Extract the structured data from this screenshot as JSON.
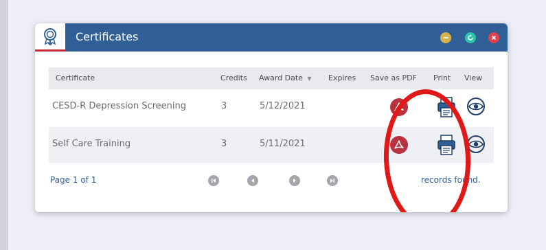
{
  "window": {
    "title": "Certificates",
    "title_icon": "award-icon",
    "controls": [
      "minimize-icon",
      "refresh-icon",
      "close-icon"
    ]
  },
  "table": {
    "headers": {
      "certificate": "Certificate",
      "credits": "Credits",
      "award_date": "Award Date",
      "sort_indicator": "▼",
      "expires": "Expires",
      "save_as_pdf": "Save as PDF",
      "print": "Print",
      "view": "View"
    },
    "rows": [
      {
        "certificate": "CESD-R Depression Screening",
        "credits": "3",
        "award_date": "5/12/2021",
        "expires": ""
      },
      {
        "certificate": "Self Care Training",
        "credits": "3",
        "award_date": "5/11/2021",
        "expires": ""
      }
    ]
  },
  "pager": {
    "page_text": "Page 1 of 1",
    "records_text": "records found."
  },
  "colors": {
    "header_blue": "#2f5f94",
    "pdf_red": "#b8323f",
    "annotation_red": "#e01818"
  }
}
